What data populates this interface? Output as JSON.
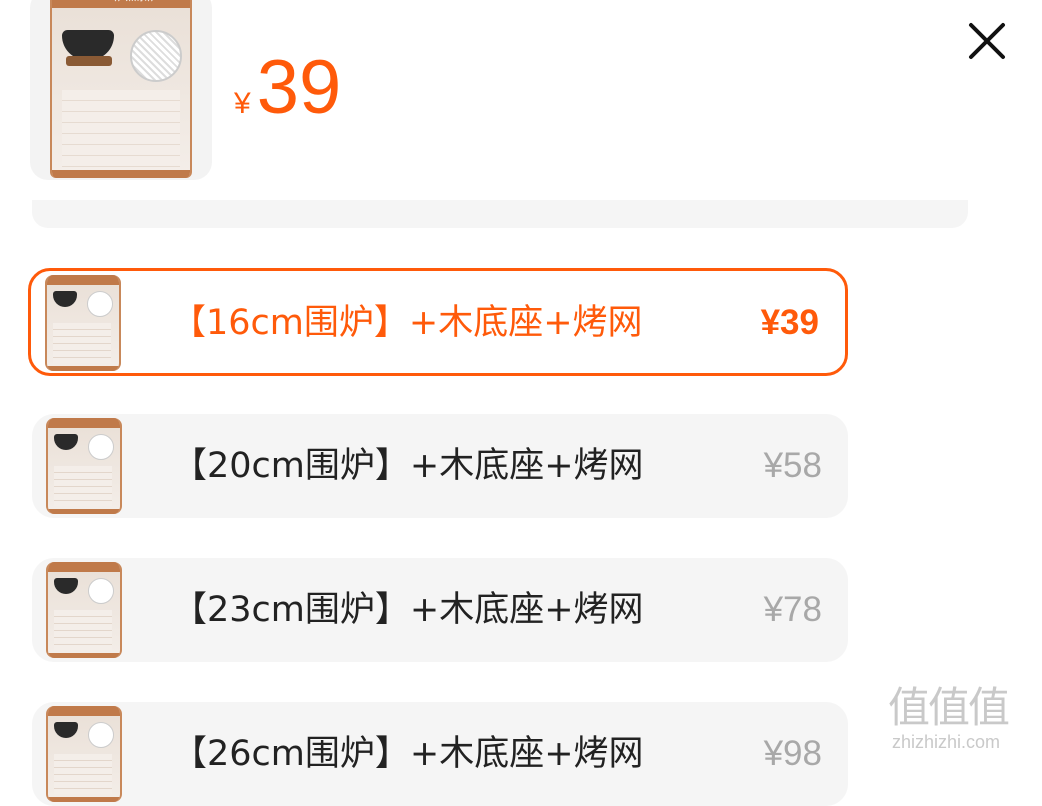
{
  "product": {
    "thumbnail_banner": "#16cm炉煮茶炉#",
    "currency_symbol": "¥",
    "price": "39"
  },
  "options": [
    {
      "label": "【16cm围炉】+木底座+烤网",
      "price": "¥39",
      "selected": true
    },
    {
      "label": "【20cm围炉】+木底座+烤网",
      "price": "¥58",
      "selected": false
    },
    {
      "label": "【23cm围炉】+木底座+烤网",
      "price": "¥78",
      "selected": false
    },
    {
      "label": "【26cm围炉】+木底座+烤网",
      "price": "¥98",
      "selected": false
    }
  ],
  "watermark": {
    "glyphs": "值值值",
    "site": "zhizhizhi.com"
  },
  "colors": {
    "accent": "#ff5a0a",
    "muted_price": "#a8a8a8",
    "option_bg": "#f5f5f5"
  },
  "icons": {
    "close": "close-icon"
  }
}
